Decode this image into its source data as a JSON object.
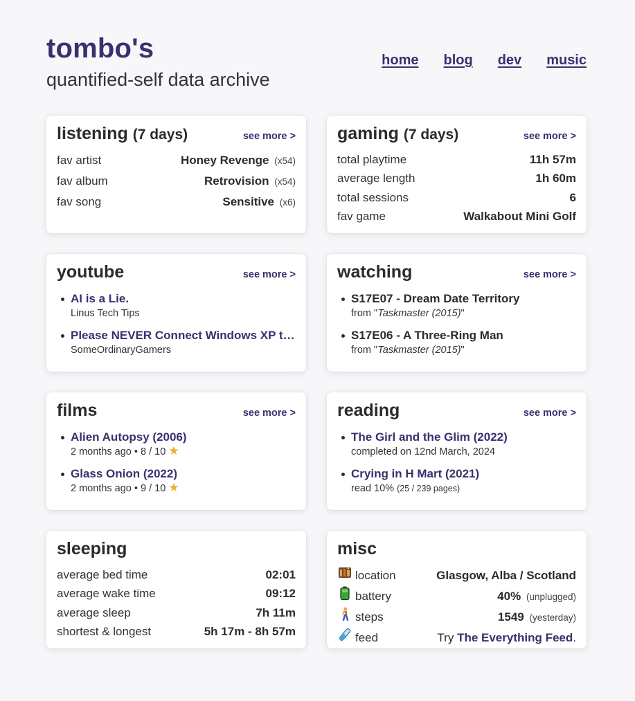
{
  "header": {
    "title": "tombo's",
    "subtitle": "quantified-self data archive",
    "nav": [
      "home",
      "blog",
      "dev",
      "music"
    ]
  },
  "see_more": "see more >",
  "listening": {
    "title": "listening",
    "period": "(7 days)",
    "rows": [
      {
        "label": "fav artist",
        "value": "Honey Revenge",
        "count": "(x54)"
      },
      {
        "label": "fav album",
        "value": "Retrovision",
        "count": "(x54)"
      },
      {
        "label": "fav song",
        "value": "Sensitive",
        "count": "(x6)"
      }
    ]
  },
  "gaming": {
    "title": "gaming",
    "period": "(7 days)",
    "rows": [
      {
        "label": "total playtime",
        "value": "11h 57m"
      },
      {
        "label": "average length",
        "value": "1h 60m"
      },
      {
        "label": "total sessions",
        "value": "6"
      },
      {
        "label": "fav game",
        "value": "Walkabout Mini Golf"
      }
    ]
  },
  "youtube": {
    "title": "youtube",
    "items": [
      {
        "title": "AI is a Lie.",
        "channel": "Linus Tech Tips"
      },
      {
        "title": "Please NEVER Connect Windows XP to the Internet",
        "channel": "SomeOrdinaryGamers"
      }
    ]
  },
  "watching": {
    "title": "watching",
    "items": [
      {
        "title": "S17E07 - Dream Date Territory",
        "from_prefix": "from \"",
        "show": "Taskmaster (2015)",
        "from_suffix": "\""
      },
      {
        "title": "S17E06 - A Three-Ring Man",
        "from_prefix": "from \"",
        "show": "Taskmaster (2015)",
        "from_suffix": "\""
      }
    ]
  },
  "films": {
    "title": "films",
    "items": [
      {
        "title": "Alien Autopsy (2006)",
        "meta": "2 months ago • 8 / 10"
      },
      {
        "title": "Glass Onion (2022)",
        "meta": "2 months ago • 9 / 10"
      }
    ]
  },
  "reading": {
    "title": "reading",
    "items": [
      {
        "title": "The Girl and the Glim (2022)",
        "meta": "completed on 12nd March, 2024",
        "pages": ""
      },
      {
        "title": "Crying in H Mart (2021)",
        "meta": "read 10%",
        "pages": "(25 / 239 pages)"
      }
    ]
  },
  "sleeping": {
    "title": "sleeping",
    "rows": [
      {
        "label": "average bed time",
        "value": "02:01"
      },
      {
        "label": "average wake time",
        "value": "09:12"
      },
      {
        "label": "average sleep",
        "value": "7h 11m"
      },
      {
        "label": "shortest & longest",
        "value": "5h 17m - 8h 57m"
      }
    ]
  },
  "misc": {
    "title": "misc",
    "location": {
      "label": "location",
      "value": "Glasgow, Alba / Scotland",
      "icon": "city-icon"
    },
    "battery": {
      "label": "battery",
      "value": "40%",
      "note": "(unplugged)",
      "icon": "battery-icon"
    },
    "steps": {
      "label": "steps",
      "value": "1549",
      "note": "(yesterday)",
      "icon": "walking-person-icon"
    },
    "feed": {
      "label": "feed",
      "prefix": "Try",
      "link": "The Everything Feed",
      "suffix": ".",
      "icon": "test-tube-icon"
    }
  },
  "colors": {
    "accent": "#3b2f6e",
    "text": "#2b2b2f",
    "background": "#f7f7fa",
    "star": "#e8b12a"
  }
}
